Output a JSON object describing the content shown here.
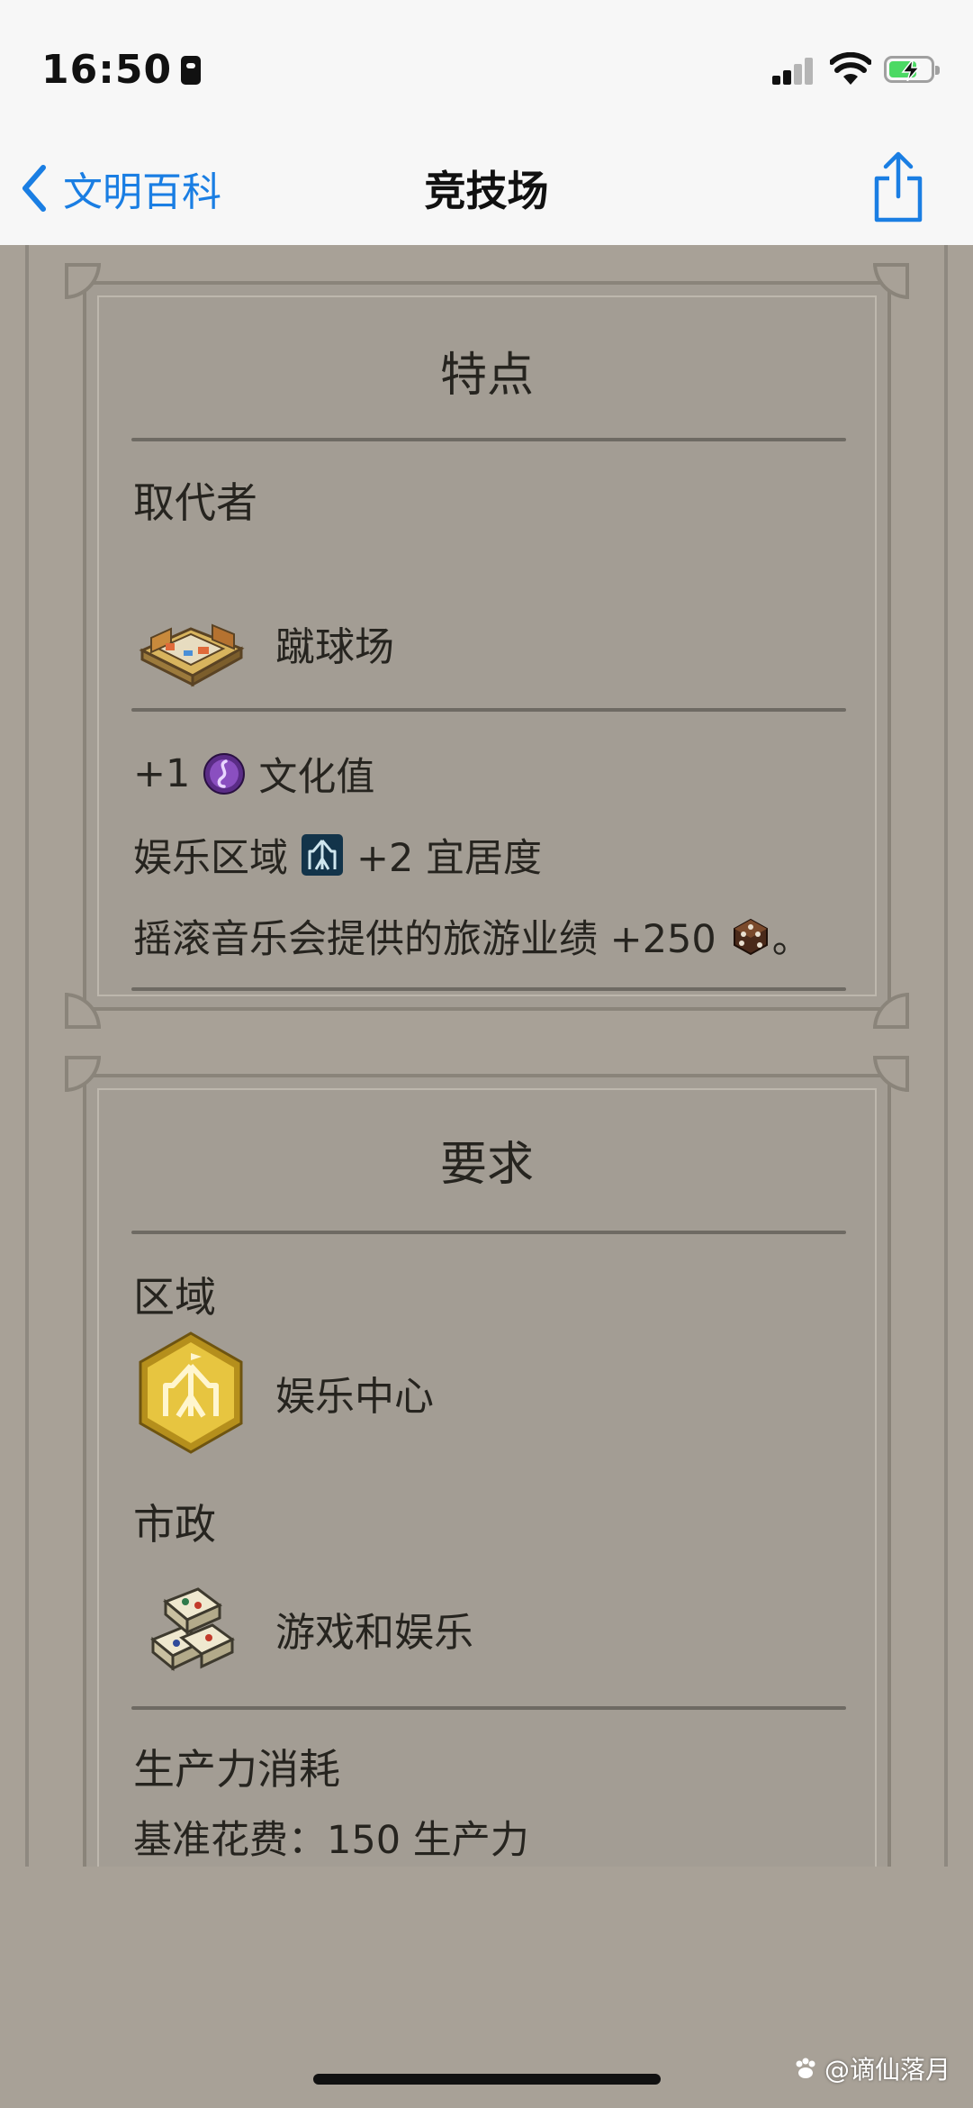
{
  "status_bar": {
    "time": "16:50",
    "battery_color": "#4cd964"
  },
  "nav": {
    "back_label": "文明百科",
    "title": "竞技场",
    "accent": "#1a7ee3"
  },
  "features": {
    "title": "特点",
    "replacer_label": "取代者",
    "replacer_item": "蹴球场",
    "line1": {
      "prefix": "+1",
      "icon": "culture-icon",
      "suffix": "文化值"
    },
    "line2": {
      "prefix": "娱乐区域",
      "icon": "entertainment-district-icon",
      "suffix": "+2 宜居度"
    },
    "line3": {
      "prefix": "摇滚音乐会提供的旅游业绩 +250",
      "icon": "tourism-icon",
      "suffix": "。"
    }
  },
  "requirements": {
    "title": "要求",
    "district_label": "区域",
    "district_item": "娱乐中心",
    "civic_label": "市政",
    "civic_item": "游戏和娱乐",
    "production_label": "生产力消耗",
    "production_line": "基准花费：150 生产力"
  },
  "watermark": "@谪仙落月"
}
